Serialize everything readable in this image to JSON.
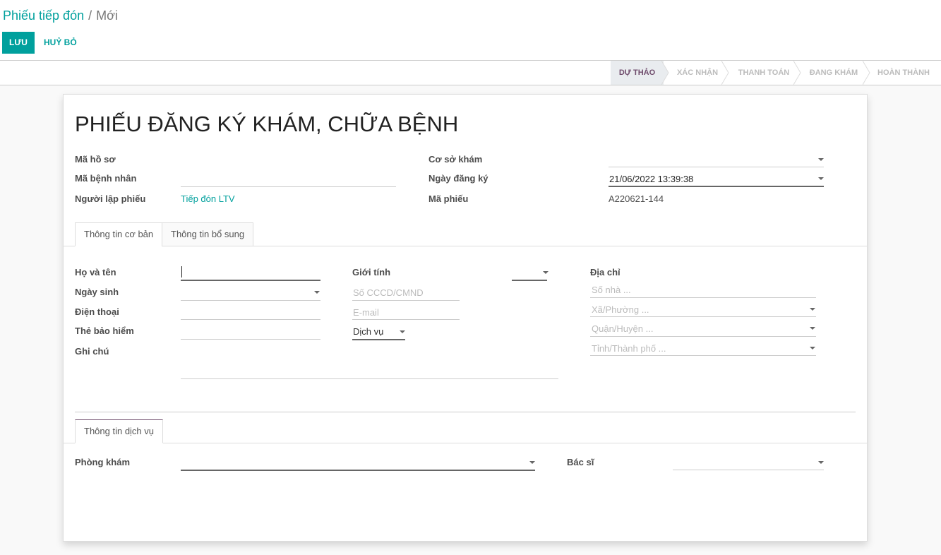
{
  "breadcrumb": {
    "parent": "Phiếu tiếp đón",
    "separator": "/",
    "current": "Mới"
  },
  "toolbar": {
    "save_label": "LƯU",
    "discard_label": "HUỶ BỎ"
  },
  "status": {
    "stages": [
      "DỰ THẢO",
      "XÁC NHẬN",
      "THANH TOÁN",
      "ĐANG KHÁM",
      "HOÀN THÀNH"
    ],
    "active": "DỰ THẢO"
  },
  "form": {
    "title": "PHIẾU ĐĂNG KÝ KHÁM, CHỮA BỆNH",
    "ma_ho_so_label": "Mã hồ sơ",
    "ma_benh_nhan_label": "Mã bệnh nhân",
    "nguoi_lap_label": "Người lập phiếu",
    "nguoi_lap_value": "Tiếp đón LTV",
    "co_so_label": "Cơ sở khám",
    "ngay_dk_label": "Ngày đăng ký",
    "ngay_dk_value": "21/06/2022 13:39:38",
    "ma_phieu_label": "Mã phiếu",
    "ma_phieu_value": "A220621-144"
  },
  "tabs": [
    "Thông tin cơ bản",
    "Thông tin bổ sung"
  ],
  "basic": {
    "ho_ten": "Họ và tên",
    "ngay_sinh": "Ngày sinh",
    "dien_thoai": "Điện thoại",
    "the_bh": "Thẻ bảo hiểm",
    "ghi_chu": "Ghi chú",
    "gioi_tinh": "Giới tính",
    "cccd_ph": "Số CCCD/CMND",
    "email_ph": "E-mail",
    "dich_vu": "Dịch vụ",
    "dia_chi": "Địa chỉ",
    "so_nha_ph": "Số nhà ...",
    "xa_ph": "Xã/Phường ...",
    "quan_ph": "Quận/Huyện ...",
    "tinh_ph": "Tỉnh/Thành phố ..."
  },
  "service_tab": "Thông tin dịch vụ",
  "service": {
    "phong_kham": "Phòng khám",
    "bac_si": "Bác sĩ"
  },
  "colors": {
    "primary": "#00a09d",
    "status_active": "#6f4c6c"
  }
}
